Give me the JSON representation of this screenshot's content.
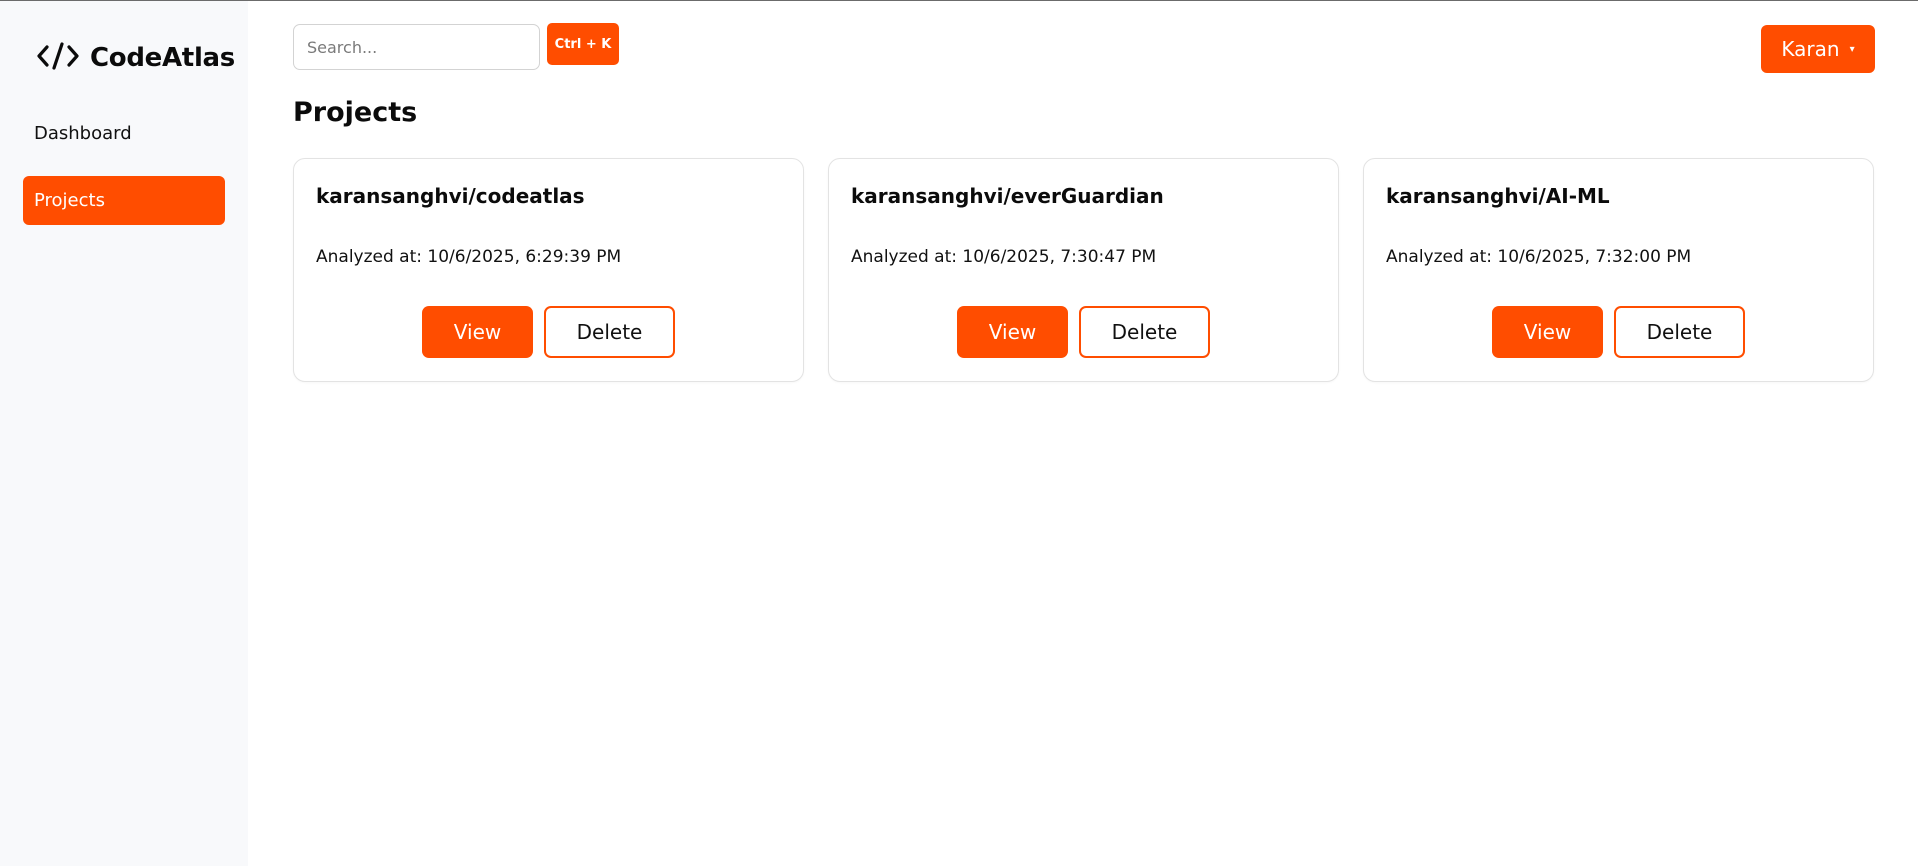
{
  "brand": {
    "name": "CodeAtlas",
    "icon": "code-brackets-icon"
  },
  "sidebar": {
    "items": [
      {
        "label": "Dashboard",
        "active": false
      },
      {
        "label": "Projects",
        "active": true
      }
    ]
  },
  "topbar": {
    "search_placeholder": "Search...",
    "shortcut": "Ctrl + K",
    "user": "Karan",
    "user_caret": "▾"
  },
  "page": {
    "title": "Projects"
  },
  "projects": [
    {
      "name": "karansanghvi/codeatlas",
      "analyzed": "Analyzed at: 10/6/2025, 6:29:39 PM",
      "view": "View",
      "delete": "Delete"
    },
    {
      "name": "karansanghvi/everGuardian",
      "analyzed": "Analyzed at: 10/6/2025, 7:30:47 PM",
      "view": "View",
      "delete": "Delete"
    },
    {
      "name": "karansanghvi/AI-ML",
      "analyzed": "Analyzed at: 10/6/2025, 7:32:00 PM",
      "view": "View",
      "delete": "Delete"
    }
  ],
  "colors": {
    "accent": "#ff4d00",
    "sidebar_bg": "#f8f9fb",
    "card_border": "#e3e3e3"
  }
}
